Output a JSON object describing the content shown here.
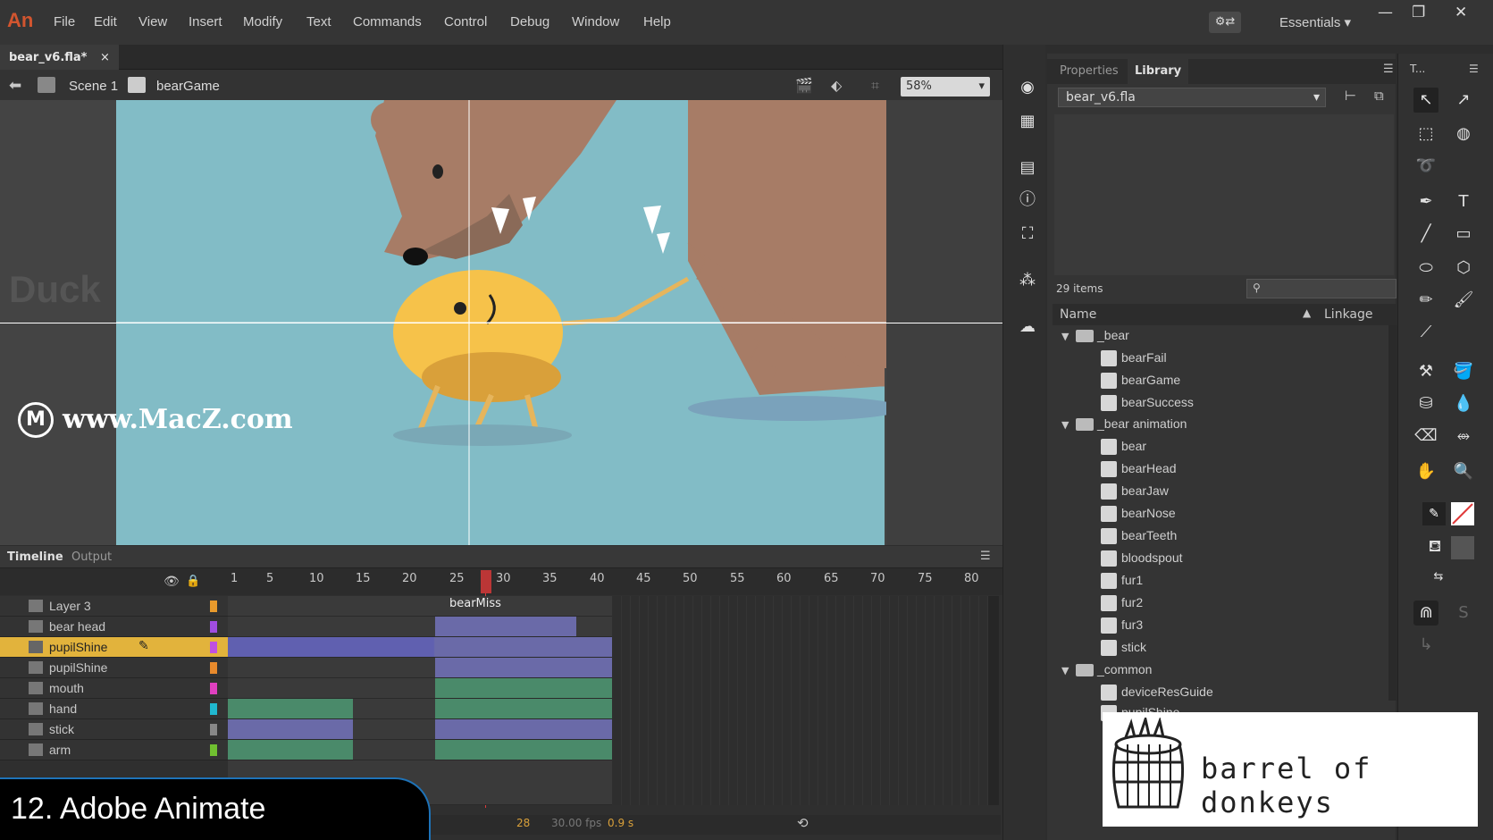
{
  "app": {
    "logo": "An"
  },
  "menu": [
    "File",
    "Edit",
    "View",
    "Insert",
    "Modify",
    "Text",
    "Commands",
    "Control",
    "Debug",
    "Window",
    "Help"
  ],
  "workspace": "Essentials",
  "window_controls": {
    "minimize": "—",
    "restore": "❐",
    "close": "✕"
  },
  "document": {
    "tab": "bear_v6.fla*",
    "close": "×"
  },
  "scene_bar": {
    "scene": "Scene 1",
    "symbol": "bearGame",
    "zoom": "58%"
  },
  "stage": {
    "ghost_text": "Duck"
  },
  "watermark": "www.MacZ.com",
  "timeline": {
    "tabs": [
      "Timeline",
      "Output"
    ],
    "ruler": [
      "1",
      "5",
      "10",
      "15",
      "20",
      "25",
      "30",
      "35",
      "40",
      "45",
      "50",
      "55",
      "60",
      "65",
      "70",
      "75",
      "80"
    ],
    "frame_label": "bearMiss",
    "layers": [
      "Layer 3",
      "bear head",
      "pupilShine",
      "pupilShine",
      "mouth",
      "hand",
      "stick",
      "arm"
    ],
    "status": {
      "frame": "28",
      "fps": "30.00 fps",
      "time": "0.9 s"
    }
  },
  "library": {
    "tabs": [
      "Properties",
      "Library"
    ],
    "document": "bear_v6.fla",
    "count": "29 items",
    "columns": {
      "name": "Name",
      "linkage": "Linkage"
    },
    "folders": [
      {
        "name": "_bear",
        "items": [
          "bearFail",
          "bearGame",
          "bearSuccess"
        ]
      },
      {
        "name": "_bear animation",
        "items": [
          "bear",
          "bearHead",
          "bearJaw",
          "bearNose",
          "bearTeeth",
          "bloodspout",
          "fur1",
          "fur2",
          "fur3",
          "stick"
        ]
      },
      {
        "name": "_common",
        "items": [
          "deviceResGuide",
          "pupilShine"
        ]
      }
    ]
  },
  "tools_header": "T...",
  "caption": "12.  Adobe Animate",
  "overlay_brand": "barrel of donkeys",
  "colors": {
    "accent": "#d2552f",
    "stage": "#82bcc6",
    "selected_layer": "#e2b33c",
    "playhead": "#e03a3a"
  }
}
